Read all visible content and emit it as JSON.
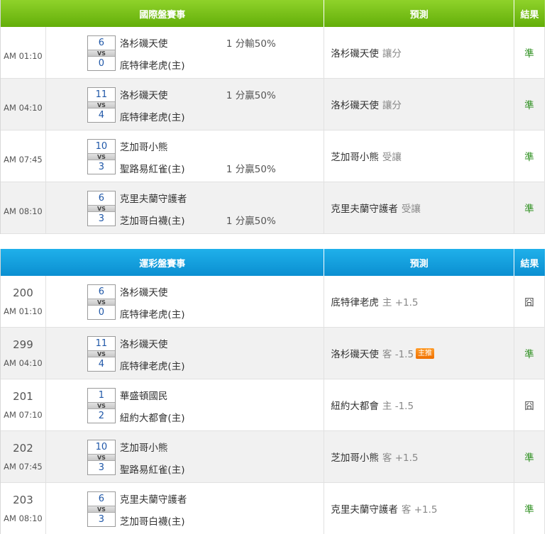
{
  "intl": {
    "headers": {
      "match": "國際盤賽事",
      "predict": "預測",
      "result": "結果"
    },
    "rows": [
      {
        "time": "AM 01:10",
        "score_home": "6",
        "score_away": "0",
        "vs": "VS",
        "team1": "洛杉磯天使",
        "team2": "底特律老虎(主)",
        "hcp_top": "1 分輸50%",
        "hcp_bot": "",
        "pick": "洛杉磯天使",
        "pick_type": "讓分",
        "result": "準",
        "win": true
      },
      {
        "time": "AM 04:10",
        "score_home": "11",
        "score_away": "4",
        "vs": "VS",
        "team1": "洛杉磯天使",
        "team2": "底特律老虎(主)",
        "hcp_top": "1 分贏50%",
        "hcp_bot": "",
        "pick": "洛杉磯天使",
        "pick_type": "讓分",
        "result": "準",
        "win": true
      },
      {
        "time": "AM 07:45",
        "score_home": "10",
        "score_away": "3",
        "vs": "VS",
        "team1": "芝加哥小熊",
        "team2": "聖路易紅雀(主)",
        "hcp_top": "",
        "hcp_bot": "1 分贏50%",
        "pick": "芝加哥小熊",
        "pick_type": "受讓",
        "result": "準",
        "win": true
      },
      {
        "time": "AM 08:10",
        "score_home": "6",
        "score_away": "3",
        "vs": "VS",
        "team1": "克里夫蘭守護者",
        "team2": "芝加哥白襪(主)",
        "hcp_top": "",
        "hcp_bot": "1 分贏50%",
        "pick": "克里夫蘭守護者",
        "pick_type": "受讓",
        "result": "準",
        "win": true
      }
    ]
  },
  "sports": {
    "headers": {
      "match": "運彩盤賽事",
      "predict": "預測",
      "result": "結果"
    },
    "rows": [
      {
        "code": "200",
        "time": "AM 01:10",
        "score_home": "6",
        "score_away": "0",
        "vs": "VS",
        "team1": "洛杉磯天使",
        "team2": "底特律老虎(主)",
        "pick": "底特律老虎",
        "pick_type": "主 +1.5",
        "badge": "",
        "result": "囧",
        "win": false
      },
      {
        "code": "299",
        "time": "AM 04:10",
        "score_home": "11",
        "score_away": "4",
        "vs": "VS",
        "team1": "洛杉磯天使",
        "team2": "底特律老虎(主)",
        "pick": "洛杉磯天使",
        "pick_type": "客 -1.5",
        "badge": "主推",
        "result": "準",
        "win": true
      },
      {
        "code": "201",
        "time": "AM 07:10",
        "score_home": "1",
        "score_away": "2",
        "vs": "VS",
        "team1": "華盛頓國民",
        "team2": "紐約大都會(主)",
        "pick": "紐約大都會",
        "pick_type": "主 -1.5",
        "badge": "",
        "result": "囧",
        "win": false
      },
      {
        "code": "202",
        "time": "AM 07:45",
        "score_home": "10",
        "score_away": "3",
        "vs": "VS",
        "team1": "芝加哥小熊",
        "team2": "聖路易紅雀(主)",
        "pick": "芝加哥小熊",
        "pick_type": "客 +1.5",
        "badge": "",
        "result": "準",
        "win": true
      },
      {
        "code": "203",
        "time": "AM 08:10",
        "score_home": "6",
        "score_away": "3",
        "vs": "VS",
        "team1": "克里夫蘭守護者",
        "team2": "芝加哥白襪(主)",
        "pick": "克里夫蘭守護者",
        "pick_type": "客 +1.5",
        "badge": "",
        "result": "準",
        "win": true
      }
    ]
  }
}
